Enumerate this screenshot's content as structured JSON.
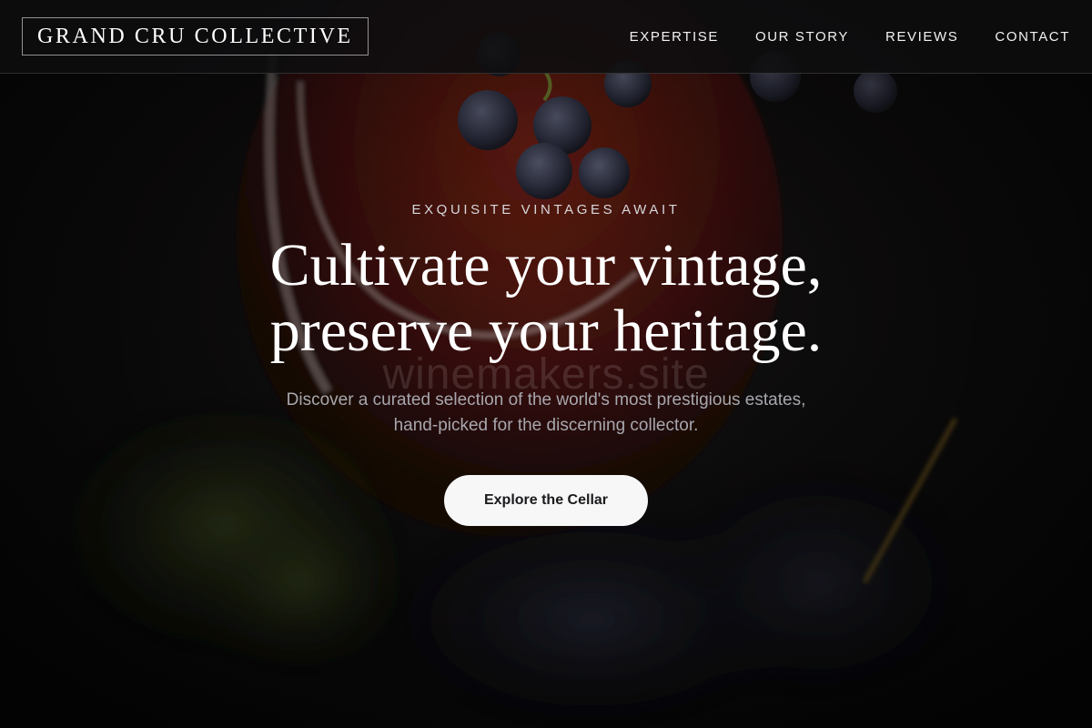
{
  "brand": {
    "name": "GRAND CRU COLLECTIVE"
  },
  "nav": {
    "items": [
      {
        "label": "EXPERTISE"
      },
      {
        "label": "OUR STORY"
      },
      {
        "label": "REVIEWS"
      },
      {
        "label": "CONTACT"
      }
    ]
  },
  "hero": {
    "eyebrow": "EXQUISITE VINTAGES AWAIT",
    "headline_line1": "Cultivate your vintage,",
    "headline_line2": "preserve your heritage.",
    "watermark": "winemakers.site",
    "subtext_line1": "Discover a curated selection of the world's most prestigious estates,",
    "subtext_line2": "hand-picked for the discerning collector.",
    "cta_label": "Explore the Cellar"
  },
  "colors": {
    "background": "#0b0b0c",
    "wine_red": "#7a1c12",
    "grape": "#4a4e66",
    "cta_bg": "#f7f7f8",
    "cta_text": "#1a1a1c"
  }
}
